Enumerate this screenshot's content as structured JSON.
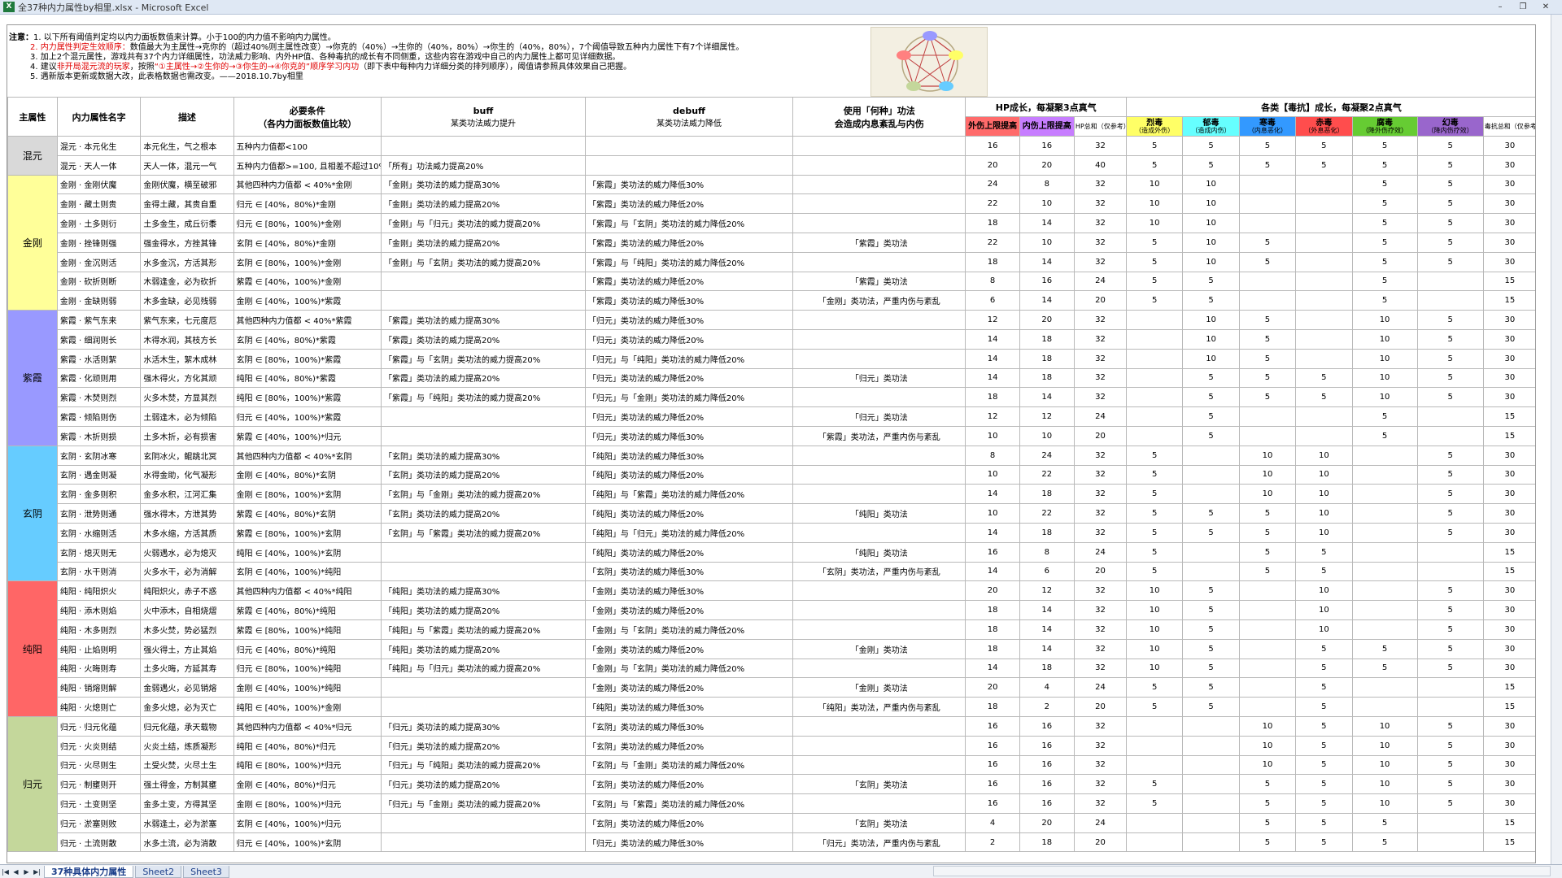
{
  "window": {
    "title": "全37种内力属性by相里.xlsx - Microsoft Excel",
    "app_icon": "excel-icon"
  },
  "notes": {
    "label": "注意：",
    "line1": "1. 以下所有阈值判定均以内力面板数值来计算。小于100的内力值不影响内力属性。",
    "line2_red": "2. 内力属性判定生效顺序：",
    "line2_rest": "数值最大为主属性→克你的（超过40%则主属性改变）→你克的（40%）→生你的（40%，80%）→你生的（40%，80%），7个阈值导致五种内力属性下有7个详细属性。",
    "line3": "3. 加上2个混元属性，游戏共有37个内力详细属性，功法威力影响、内外HP值、各种毒抗的成长有不同侧重，这些内容在游戏中自己的内力属性上都可见详细数据。",
    "line4_a": "4. 建议",
    "line4_red1": "非开局混元流的玩家",
    "line4_b": "，按照",
    "line4_red2": "“①主属性→②生你的→③你生的→④你克的”顺序学习内功",
    "line4_c": "（即下表中每种内力详细分类的排列顺序），阈值请参照具体效果自己把握。",
    "line5": "5. 遇新版本更新或数据大改，此表格数据也需改变。——2018.10.7by相里"
  },
  "headers": {
    "main_attr": "主属性",
    "name": "内力属性名字",
    "desc": "描述",
    "cond": "必要条件",
    "cond_sub": "（各内力面板数值比较）",
    "buff": "buff",
    "buff_sub": "某类功法威力提升",
    "debuff": "debuff",
    "debuff_sub": "某类功法威力降低",
    "use": "使用「何种」功法",
    "use_sub": "会造成内息紊乱与内伤",
    "hp_group": "HP成长，每凝聚3点真气",
    "hp_outer": "外伤上限提高",
    "hp_inner": "内伤上限提高",
    "hp_total": "HP总和（仅参考）",
    "poison_group": "各类【毒抗】成长，每凝聚2点真气",
    "poisons": [
      {
        "name": "烈毒",
        "sub": "（造成外伤）",
        "color": "#ffff66"
      },
      {
        "name": "郁毒",
        "sub": "（造成内伤）",
        "color": "#66ffff"
      },
      {
        "name": "寒毒",
        "sub": "（内息恶化）",
        "color": "#3399ff"
      },
      {
        "name": "赤毒",
        "sub": "（外息恶化）",
        "color": "#ff4d4d"
      },
      {
        "name": "腐毒",
        "sub": "（降外伤疗效）",
        "color": "#66cc33"
      },
      {
        "name": "幻毒",
        "sub": "（降内伤疗效）",
        "color": "#9966cc"
      }
    ],
    "poison_total": "毒抗总和（仅参考）",
    "hp_outer_color": "#ff6b6b",
    "hp_inner_color": "#c77dff"
  },
  "groups": [
    {
      "name": "混元",
      "color": "#d9d9d9",
      "rows": [
        [
          "混元 · 本元化生",
          "本元化生，气之根本",
          "五种内力值都<100",
          "",
          "",
          "",
          "16",
          "16",
          "32",
          "5",
          "5",
          "5",
          "5",
          "5",
          "5",
          "30"
        ],
        [
          "混元 · 天人一体",
          "天人一体，混元一气",
          "五种内力值都>=100, 且相差不超过10%",
          "「所有」功法威力提高20%",
          "",
          "",
          "20",
          "20",
          "40",
          "5",
          "5",
          "5",
          "5",
          "5",
          "5",
          "30"
        ]
      ]
    },
    {
      "name": "金刚",
      "color": "#ffff99",
      "rows": [
        [
          "金刚 · 金刚伏魔",
          "金刚伏魔，横至破邪",
          "其他四种内力值都 < 40%*金刚",
          "「金刚」类功法的威力提高30%",
          "「紫霞」类功法的威力降低30%",
          "",
          "24",
          "8",
          "32",
          "10",
          "10",
          "",
          "",
          "5",
          "5",
          "30"
        ],
        [
          "金刚 · 藏土则贵",
          "金得土藏，其贵自重",
          "归元 ∈ [40%，80%)*金刚",
          "「金刚」类功法的威力提高20%",
          "「紫霞」类功法的威力降低20%",
          "",
          "22",
          "10",
          "32",
          "10",
          "10",
          "",
          "",
          "5",
          "5",
          "30"
        ],
        [
          "金刚 · 土多则衍",
          "土多金生，成丘衍黍",
          "归元 ∈ [80%，100%)*金刚",
          "「金刚」与「归元」类功法的威力提高20%",
          "「紫霞」与「玄阴」类功法的威力降低20%",
          "",
          "18",
          "14",
          "32",
          "10",
          "10",
          "",
          "",
          "5",
          "5",
          "30"
        ],
        [
          "金刚 · 挫锋则强",
          "强金得水，方挫其锋",
          "玄阴 ∈ [40%，80%)*金刚",
          "「金刚」类功法的威力提高20%",
          "「紫霞」类功法的威力降低20%",
          "「紫霞」类功法",
          "22",
          "10",
          "32",
          "5",
          "10",
          "5",
          "",
          "5",
          "5",
          "30"
        ],
        [
          "金刚 · 金沉则活",
          "水多金沉，方活其形",
          "玄阴 ∈ [80%，100%)*金刚",
          "「金刚」与「玄阴」类功法的威力提高20%",
          "「紫霞」与「纯阳」类功法的威力降低20%",
          "",
          "18",
          "14",
          "32",
          "5",
          "10",
          "5",
          "",
          "5",
          "5",
          "30"
        ],
        [
          "金刚 · 砍折则断",
          "木弱逢金，必为砍折",
          "紫霞 ∈ [40%，100%)*金刚",
          "",
          "「紫霞」类功法的威力降低20%",
          "「紫霞」类功法",
          "8",
          "16",
          "24",
          "5",
          "5",
          "",
          "",
          "5",
          "",
          "15"
        ],
        [
          "金刚 · 金缺则弱",
          "木多金缺，必见残弱",
          "金刚 ∈ [40%，100%)*紫霞",
          "",
          "「紫霞」类功法的威力降低30%",
          "「金刚」类功法，严重内伤与紊乱",
          "6",
          "14",
          "20",
          "5",
          "5",
          "",
          "",
          "5",
          "",
          "15"
        ]
      ]
    },
    {
      "name": "紫霞",
      "color": "#9999ff",
      "rows": [
        [
          "紫霞 · 紫气东来",
          "紫气东来，七元度厄",
          "其他四种内力值都 < 40%*紫霞",
          "「紫霞」类功法的威力提高30%",
          "「归元」类功法的威力降低30%",
          "",
          "12",
          "20",
          "32",
          "",
          "10",
          "5",
          "",
          "10",
          "5",
          "30"
        ],
        [
          "紫霞 · 细润则长",
          "木得水润，其枝方长",
          "玄阴 ∈ [40%，80%)*紫霞",
          "「紫霞」类功法的威力提高20%",
          "「归元」类功法的威力降低20%",
          "",
          "14",
          "18",
          "32",
          "",
          "10",
          "5",
          "",
          "10",
          "5",
          "30"
        ],
        [
          "紫霞 · 水活则絮",
          "水活木生，絮木成林",
          "玄阴 ∈ [80%，100%)*紫霞",
          "「紫霞」与「玄阴」类功法的威力提高20%",
          "「归元」与「纯阳」类功法的威力降低20%",
          "",
          "14",
          "18",
          "32",
          "",
          "10",
          "5",
          "",
          "10",
          "5",
          "30"
        ],
        [
          "紫霞 · 化顽则用",
          "强木得火，方化其顽",
          "纯阳 ∈ [40%，80%)*紫霞",
          "「紫霞」类功法的威力提高20%",
          "「归元」类功法的威力降低20%",
          "「归元」类功法",
          "14",
          "18",
          "32",
          "",
          "5",
          "5",
          "5",
          "10",
          "5",
          "30"
        ],
        [
          "紫霞 · 木焚则烈",
          "火多木焚，方显其烈",
          "纯阳 ∈ [80%，100%)*紫霞",
          "「紫霞」与「纯阳」类功法的威力提高20%",
          "「归元」与「金刚」类功法的威力降低20%",
          "",
          "18",
          "14",
          "32",
          "",
          "5",
          "5",
          "5",
          "10",
          "5",
          "30"
        ],
        [
          "紫霞 · 倾陷则伤",
          "土弱逢木，必为倾陷",
          "归元 ∈ [40%，100%)*紫霞",
          "",
          "「归元」类功法的威力降低20%",
          "「归元」类功法",
          "12",
          "12",
          "24",
          "",
          "5",
          "",
          "",
          "5",
          "",
          "15"
        ],
        [
          "紫霞 · 木折则损",
          "土多木折，必有损害",
          "紫霞 ∈ [40%，100%)*归元",
          "",
          "「归元」类功法的威力降低30%",
          "「紫霞」类功法，严重内伤与紊乱",
          "10",
          "10",
          "20",
          "",
          "5",
          "",
          "",
          "5",
          "",
          "15"
        ]
      ]
    },
    {
      "name": "玄阴",
      "color": "#66ccff",
      "rows": [
        [
          "玄阴 · 玄阴冰寒",
          "玄阴冰火，鲲跳北冥",
          "其他四种内力值都 < 40%*玄阴",
          "「玄阴」类功法的威力提高30%",
          "「纯阳」类功法的威力降低30%",
          "",
          "8",
          "24",
          "32",
          "5",
          "",
          "10",
          "10",
          "",
          "5",
          "30"
        ],
        [
          "玄阴 · 遇金则凝",
          "水得金助，化气凝形",
          "金刚 ∈ [40%，80%)*玄阴",
          "「玄阴」类功法的威力提高20%",
          "「纯阳」类功法的威力降低20%",
          "",
          "10",
          "22",
          "32",
          "5",
          "",
          "10",
          "10",
          "",
          "5",
          "30"
        ],
        [
          "玄阴 · 金多则积",
          "金多水积，江河汇集",
          "金刚 ∈ [80%，100%)*玄阴",
          "「玄阴」与「金刚」类功法的威力提高20%",
          "「纯阳」与「紫霞」类功法的威力降低20%",
          "",
          "14",
          "18",
          "32",
          "5",
          "",
          "10",
          "10",
          "",
          "5",
          "30"
        ],
        [
          "玄阴 · 泄势则通",
          "强水得木，方泄其势",
          "紫霞 ∈ [40%，80%)*玄阴",
          "「玄阴」类功法的威力提高20%",
          "「纯阳」类功法的威力降低20%",
          "「纯阳」类功法",
          "10",
          "22",
          "32",
          "5",
          "5",
          "5",
          "10",
          "",
          "5",
          "30"
        ],
        [
          "玄阴 · 水缩则活",
          "木多水缩，方活其质",
          "紫霞 ∈ [80%，100%)*玄阴",
          "「玄阴」与「紫霞」类功法的威力提高20%",
          "「纯阳」与「归元」类功法的威力降低20%",
          "",
          "14",
          "18",
          "32",
          "5",
          "5",
          "5",
          "10",
          "",
          "5",
          "30"
        ],
        [
          "玄阴 · 熄灭则无",
          "火弱遇水，必为熄灭",
          "纯阳 ∈ [40%，100%)*玄阴",
          "",
          "「纯阳」类功法的威力降低20%",
          "「纯阳」类功法",
          "16",
          "8",
          "24",
          "5",
          "",
          "5",
          "5",
          "",
          "",
          "15"
        ],
        [
          "玄阴 · 水干则消",
          "火多水干，必为消解",
          "玄阴 ∈ [40%，100%)*纯阳",
          "",
          "「玄阴」类功法的威力降低30%",
          "「玄阴」类功法，严重内伤与紊乱",
          "14",
          "6",
          "20",
          "5",
          "",
          "5",
          "5",
          "",
          "",
          "15"
        ]
      ]
    },
    {
      "name": "纯阳",
      "color": "#ff6666",
      "rows": [
        [
          "纯阳 · 纯阳炽火",
          "纯阳炽火，赤子不惑",
          "其他四种内力值都 < 40%*纯阳",
          "「纯阳」类功法的威力提高30%",
          "「金刚」类功法的威力降低30%",
          "",
          "20",
          "12",
          "32",
          "10",
          "5",
          "",
          "10",
          "",
          "5",
          "30"
        ],
        [
          "纯阳 · 添木则焰",
          "火中添木，自相烧熠",
          "紫霞 ∈ [40%，80%)*纯阳",
          "「纯阳」类功法的威力提高20%",
          "「金刚」类功法的威力降低20%",
          "",
          "18",
          "14",
          "32",
          "10",
          "5",
          "",
          "10",
          "",
          "5",
          "30"
        ],
        [
          "纯阳 · 木多则烈",
          "木多火焚，势必猛烈",
          "紫霞 ∈ [80%，100%)*纯阳",
          "「纯阳」与「紫霞」类功法的威力提高20%",
          "「金刚」与「玄阴」类功法的威力降低20%",
          "",
          "18",
          "14",
          "32",
          "10",
          "5",
          "",
          "10",
          "",
          "5",
          "30"
        ],
        [
          "纯阳 · 止焰则明",
          "强火得土，方止其焰",
          "归元 ∈ [40%，80%)*纯阳",
          "「纯阳」类功法的威力提高20%",
          "「金刚」类功法的威力降低20%",
          "「金刚」类功法",
          "18",
          "14",
          "32",
          "10",
          "5",
          "",
          "5",
          "5",
          "5",
          "30"
        ],
        [
          "纯阳 · 火晦则寿",
          "土多火晦，方延其寿",
          "归元 ∈ [80%，100%)*纯阳",
          "「纯阳」与「归元」类功法的威力提高20%",
          "「金刚」与「玄阴」类功法的威力降低20%",
          "",
          "14",
          "18",
          "32",
          "10",
          "5",
          "",
          "5",
          "5",
          "5",
          "30"
        ],
        [
          "纯阳 · 销熔则解",
          "金弱遇火，必见销熔",
          "金刚 ∈ [40%，100%)*纯阳",
          "",
          "「金刚」类功法的威力降低20%",
          "「金刚」类功法",
          "20",
          "4",
          "24",
          "5",
          "5",
          "",
          "5",
          "",
          "",
          "15"
        ],
        [
          "纯阳 · 火熄则亡",
          "金多火熄，必为灭亡",
          "纯阳 ∈ [40%，100%)*金刚",
          "",
          "「纯阳」类功法的威力降低30%",
          "「纯阳」类功法，严重内伤与紊乱",
          "18",
          "2",
          "20",
          "5",
          "5",
          "",
          "5",
          "",
          "",
          "15"
        ]
      ]
    },
    {
      "name": "归元",
      "color": "#c4d79b",
      "rows": [
        [
          "归元 · 归元化蕴",
          "归元化蕴，承天载物",
          "其他四种内力值都 < 40%*归元",
          "「归元」类功法的威力提高30%",
          "「玄阴」类功法的威力降低30%",
          "",
          "16",
          "16",
          "32",
          "",
          "",
          "10",
          "5",
          "10",
          "5",
          "30"
        ],
        [
          "归元 · 火炎则结",
          "火炎土结，炼质凝形",
          "纯阳 ∈ [40%，80%)*归元",
          "「归元」类功法的威力提高20%",
          "「玄阴」类功法的威力降低20%",
          "",
          "16",
          "16",
          "32",
          "",
          "",
          "10",
          "5",
          "10",
          "5",
          "30"
        ],
        [
          "归元 · 火尽则生",
          "土受火焚，火尽土生",
          "纯阳 ∈ [80%，100%)*归元",
          "「归元」与「纯阳」类功法的威力提高20%",
          "「玄阴」与「金刚」类功法的威力降低20%",
          "",
          "16",
          "16",
          "32",
          "",
          "",
          "10",
          "5",
          "10",
          "5",
          "30"
        ],
        [
          "归元 · 制壅则开",
          "强土得金，方制其壅",
          "金刚 ∈ [40%，80%)*归元",
          "「归元」类功法的威力提高20%",
          "「玄阴」类功法的威力降低20%",
          "「玄阴」类功法",
          "16",
          "16",
          "32",
          "5",
          "",
          "5",
          "5",
          "10",
          "5",
          "30"
        ],
        [
          "归元 · 土变则坚",
          "金多土变，方得其坚",
          "金刚 ∈ [80%，100%)*归元",
          "「归元」与「金刚」类功法的威力提高20%",
          "「玄阴」与「紫霞」类功法的威力降低20%",
          "",
          "16",
          "16",
          "32",
          "5",
          "",
          "5",
          "5",
          "10",
          "5",
          "30"
        ],
        [
          "归元 · 淤塞则败",
          "水弱逢土，必为淤塞",
          "玄阴 ∈ [40%，100%)*归元",
          "",
          "「玄阴」类功法的威力降低20%",
          "「玄阴」类功法",
          "4",
          "20",
          "24",
          "",
          "",
          "5",
          "5",
          "5",
          "",
          "15"
        ],
        [
          "归元 · 土流则散",
          "水多土流，必为消散",
          "归元 ∈ [40%，100%)*玄阴",
          "",
          "「归元」类功法的威力降低30%",
          "「归元」类功法，严重内伤与紊乱",
          "2",
          "18",
          "20",
          "",
          "",
          "5",
          "5",
          "5",
          "",
          "15"
        ]
      ]
    }
  ],
  "tabs": [
    {
      "label": "37种具体内力属性",
      "active": true
    },
    {
      "label": "Sheet2",
      "active": false
    },
    {
      "label": "Sheet3",
      "active": false
    }
  ],
  "controls": {
    "minimize": "–",
    "restore": "❐",
    "close": "✕",
    "nav": [
      "|◀",
      "◀",
      "▶",
      "▶|"
    ]
  }
}
